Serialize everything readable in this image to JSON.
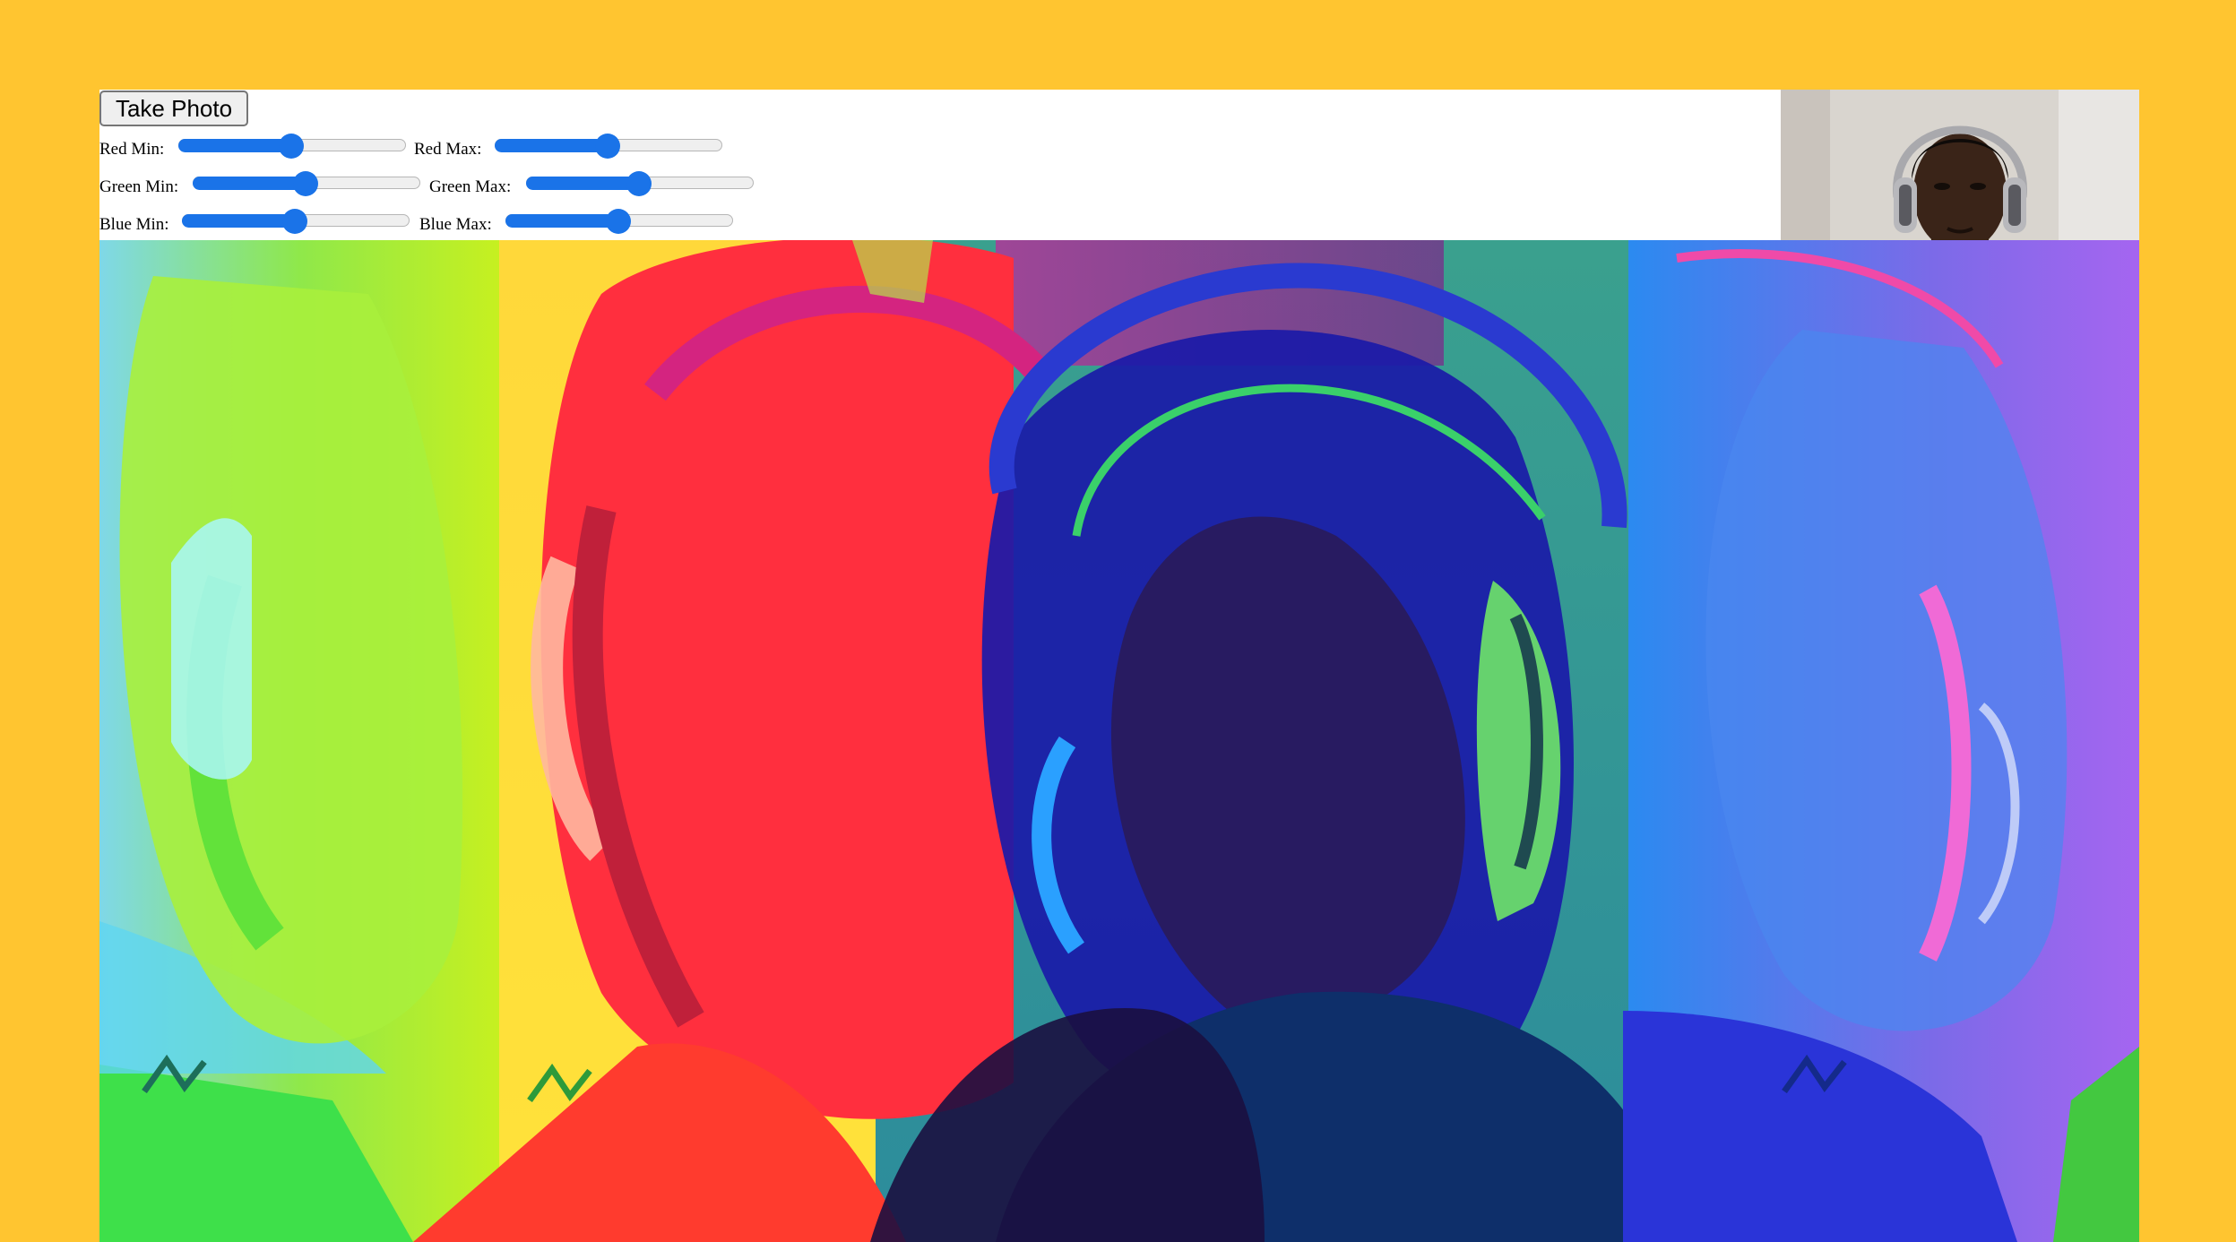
{
  "controls": {
    "take_photo_label": "Take Photo",
    "sliders": [
      {
        "label": "Red Min:",
        "value_fraction": 0.5
      },
      {
        "label": "Red Max:",
        "value_fraction": 0.5
      },
      {
        "label": "Green Min:",
        "value_fraction": 0.5
      },
      {
        "label": "Green Max:",
        "value_fraction": 0.5
      },
      {
        "label": "Blue Min:",
        "value_fraction": 0.5
      },
      {
        "label": "Blue Max:",
        "value_fraction": 0.5
      }
    ]
  },
  "colors": {
    "page_background": "#FFC530",
    "slider_accent": "#1a73e8"
  }
}
